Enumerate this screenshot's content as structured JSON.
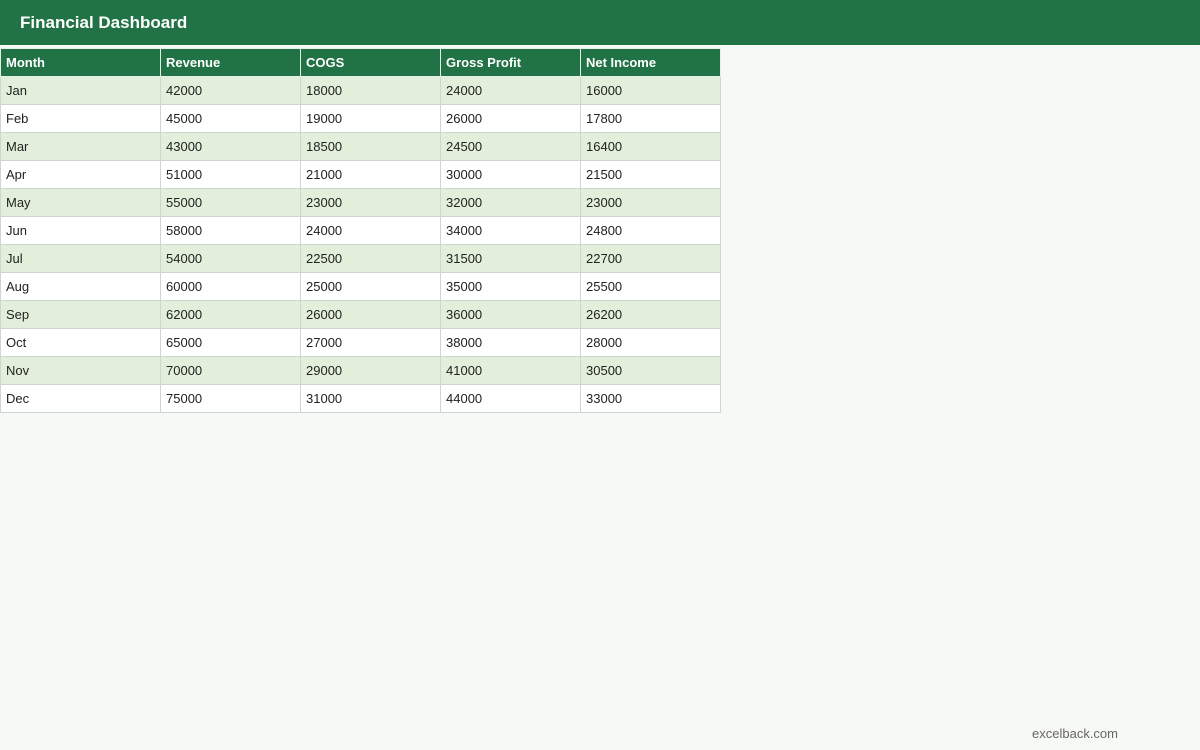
{
  "header": {
    "title": "Financial Dashboard"
  },
  "table": {
    "columns": [
      "Month",
      "Revenue",
      "COGS",
      "Gross Profit",
      "Net Income"
    ],
    "rows": [
      [
        "Jan",
        "42000",
        "18000",
        "24000",
        "16000"
      ],
      [
        "Feb",
        "45000",
        "19000",
        "26000",
        "17800"
      ],
      [
        "Mar",
        "43000",
        "18500",
        "24500",
        "16400"
      ],
      [
        "Apr",
        "51000",
        "21000",
        "30000",
        "21500"
      ],
      [
        "May",
        "55000",
        "23000",
        "32000",
        "23000"
      ],
      [
        "Jun",
        "58000",
        "24000",
        "34000",
        "24800"
      ],
      [
        "Jul",
        "54000",
        "22500",
        "31500",
        "22700"
      ],
      [
        "Aug",
        "60000",
        "25000",
        "35000",
        "25500"
      ],
      [
        "Sep",
        "62000",
        "26000",
        "36000",
        "26200"
      ],
      [
        "Oct",
        "65000",
        "27000",
        "38000",
        "28000"
      ],
      [
        "Nov",
        "70000",
        "29000",
        "41000",
        "30500"
      ],
      [
        "Dec",
        "75000",
        "31000",
        "44000",
        "33000"
      ]
    ]
  },
  "footer": {
    "brand": "excelback.com"
  },
  "colors": {
    "header_bg": "#217346",
    "row_alt": "#e2efda",
    "page_bg": "#f7f9f6"
  }
}
